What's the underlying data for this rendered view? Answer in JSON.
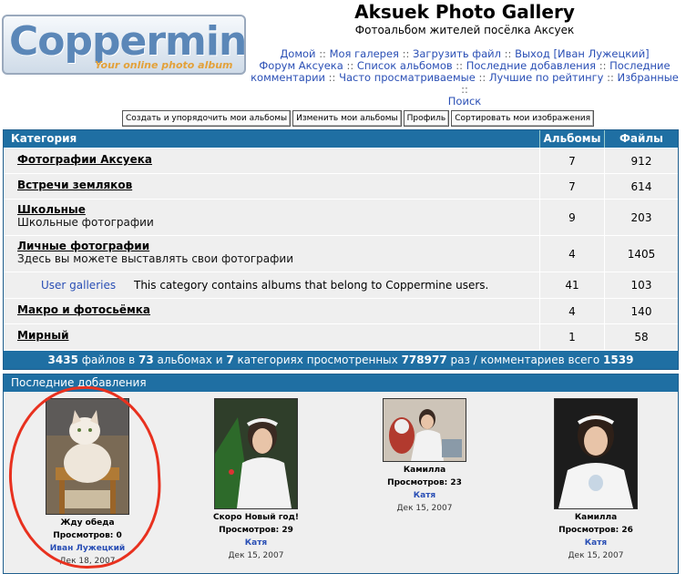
{
  "logo": {
    "main": "Coppermine",
    "sub": "Your online photo album"
  },
  "header": {
    "title": "Aksuek Photo Gallery",
    "description": "Фотоальбом жителей посёлка Аксуек"
  },
  "nav": [
    "Домой",
    "Моя галерея",
    "Загрузить файл",
    "Выход [Иван Лужецкий]",
    "Форум Аксуека",
    "Список альбомов",
    "Последние добавления",
    "Последние комментарии",
    "Часто просматриваемые",
    "Лучшие по рейтингу",
    "Избранные",
    "Поиск"
  ],
  "subnav": [
    "Создать и упорядочить мои альбомы",
    "Изменить мои альбомы",
    "Профиль",
    "Сортировать мои изображения"
  ],
  "categories": {
    "header": {
      "name": "Категория",
      "albums": "Альбомы",
      "files": "Файлы"
    },
    "rows": [
      {
        "name": "Фотографии Аксуека",
        "desc": "",
        "albums": "7",
        "files": "912"
      },
      {
        "name": "Встречи земляков",
        "desc": "",
        "albums": "7",
        "files": "614"
      },
      {
        "name": "Школьные",
        "desc": "Школьные фотографии",
        "albums": "9",
        "files": "203"
      },
      {
        "name": "Личные фотографии",
        "desc": "Здесь вы можете выставлять свои фотографии",
        "albums": "4",
        "files": "1405"
      },
      {
        "name": "Макро и фотосьёмка",
        "desc": "",
        "albums": "4",
        "files": "140"
      },
      {
        "name": "Мирный",
        "desc": "",
        "albums": "1",
        "files": "58"
      }
    ],
    "user_galleries": {
      "link": "User galleries",
      "text": "This category contains albums that belong to Coppermine users.",
      "albums": "41",
      "files": "103"
    },
    "footer": {
      "files": "3435",
      "t1": "файлов в",
      "albums": "73",
      "t2": "альбомах и",
      "cats": "7",
      "t3": "категориях просмотренных",
      "views": "778977",
      "t4": "раз / комментариев всего",
      "comments": "1539"
    }
  },
  "latest": {
    "title": "Последние добавления",
    "items": [
      {
        "title": "Жду обеда",
        "views": "Просмотров: 0",
        "owner": "Иван Лужецкий",
        "date": "Дек 18, 2007"
      },
      {
        "title": "Скоро Новый год!",
        "views": "Просмотров: 29",
        "owner": "Катя",
        "date": "Дек 15, 2007"
      },
      {
        "title": "Камилла",
        "views": "Просмотров: 23",
        "owner": "Катя",
        "date": "Дек 15, 2007"
      },
      {
        "title": "Камилла",
        "views": "Просмотров: 26",
        "owner": "Катя",
        "date": "Дек 15, 2007"
      }
    ]
  },
  "colors": {
    "header_blue": "#1f6fa3",
    "link": "#2a4fb5",
    "annotation": "#e8311f"
  }
}
